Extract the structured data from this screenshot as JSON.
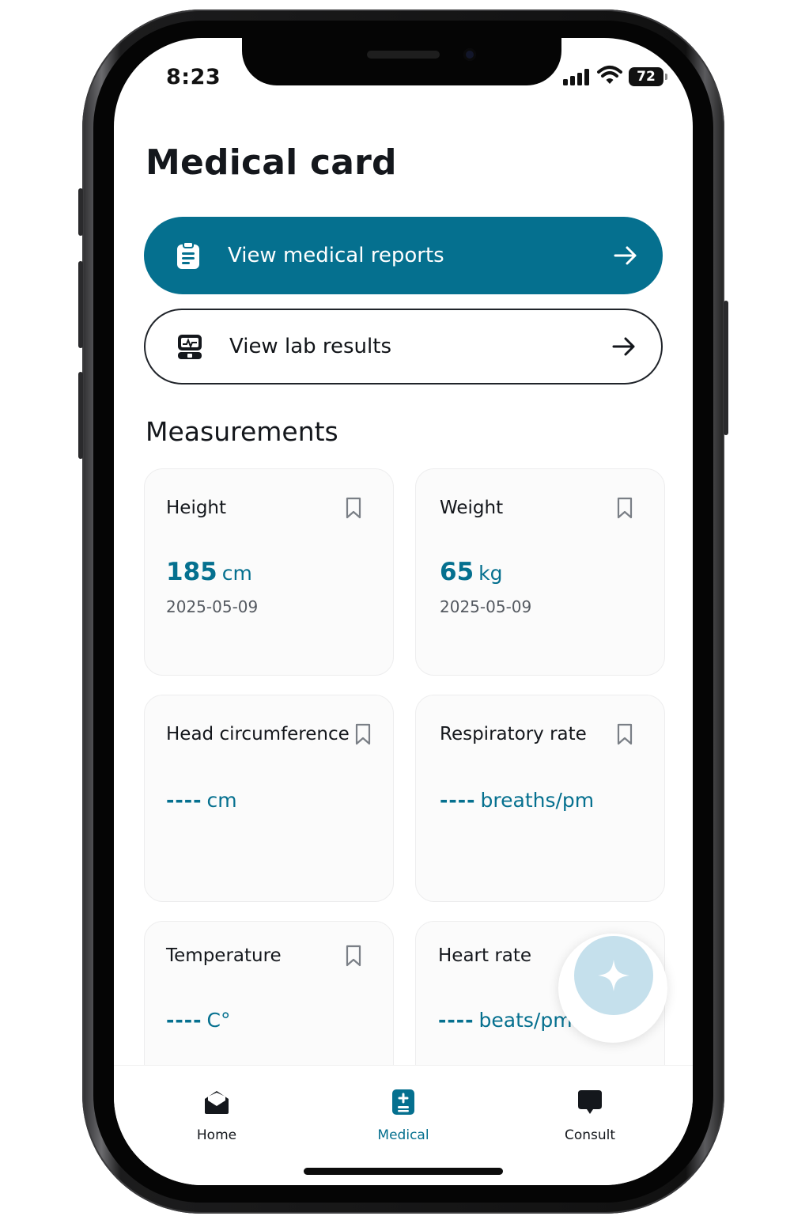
{
  "status_bar": {
    "time": "8:23",
    "battery": "72",
    "icons": [
      "signal-icon",
      "wifi-icon",
      "battery-icon"
    ]
  },
  "page": {
    "title": "Medical card"
  },
  "actions": {
    "reports": {
      "label": "View medical reports",
      "icon": "clipboard-icon",
      "trailing_icon": "arrow-right-icon"
    },
    "labs": {
      "label": "View lab results",
      "icon": "lab-monitor-icon",
      "trailing_icon": "arrow-right-icon"
    }
  },
  "measurements": {
    "title": "Measurements",
    "cards": [
      {
        "title": "Height",
        "value": "185",
        "unit": "cm",
        "date": "2025-05-09",
        "icon": "bookmark-icon"
      },
      {
        "title": "Weight",
        "value": "65",
        "unit": "kg",
        "date": "2025-05-09",
        "icon": "bookmark-icon"
      },
      {
        "title": "Head circumference",
        "value": "----",
        "unit": "cm",
        "icon": "bookmark-icon"
      },
      {
        "title": "Respiratory rate",
        "value": "----",
        "unit": "breaths/pm",
        "icon": "bookmark-icon"
      },
      {
        "title": "Temperature",
        "value": "----",
        "unit": "C°",
        "icon": "bookmark-icon"
      },
      {
        "title": "Heart rate",
        "value": "----",
        "unit": "beats/pm"
      }
    ]
  },
  "fab": {
    "icon": "sparkle-icon"
  },
  "bottom_nav": {
    "items": [
      {
        "label": "Home",
        "icon": "home-mail-icon"
      },
      {
        "label": "Medical",
        "icon": "medical-file-icon",
        "active": true
      },
      {
        "label": "Consult",
        "icon": "chat-bubble-icon"
      }
    ]
  },
  "colors": {
    "accent": "#05708f",
    "fab": "#c5e0ec",
    "text": "#14171c"
  }
}
